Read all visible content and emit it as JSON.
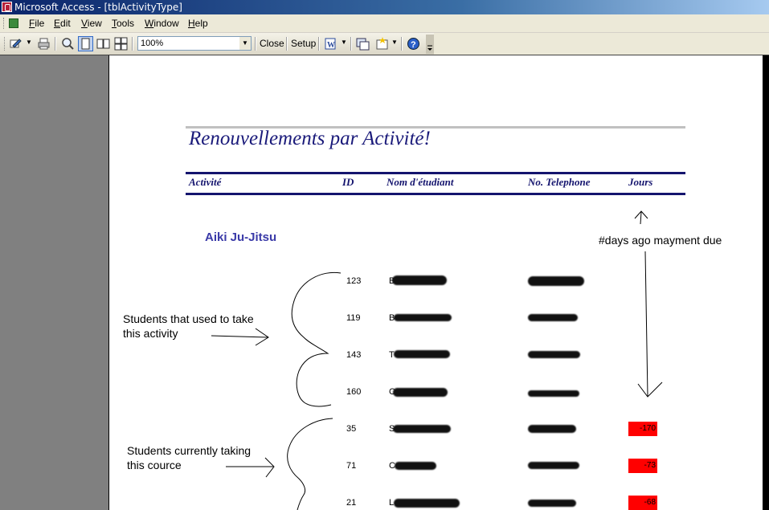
{
  "window": {
    "title": "Microsoft Access - [tblActivityType]"
  },
  "menu": {
    "items": [
      {
        "label": "File",
        "key": "F",
        "rest": "ile"
      },
      {
        "label": "Edit",
        "key": "E",
        "rest": "dit"
      },
      {
        "label": "View",
        "key": "V",
        "rest": "iew"
      },
      {
        "label": "Tools",
        "key": "T",
        "rest": "ools"
      },
      {
        "label": "Window",
        "key": "W",
        "rest": "indow"
      },
      {
        "label": "Help",
        "key": "H",
        "rest": "elp"
      }
    ]
  },
  "toolbar": {
    "zoom_value": "100%",
    "close_label": "Close",
    "setup_label": "Setup"
  },
  "report": {
    "title": "Renouvellements par Activité!",
    "columns": {
      "activite": "Activité",
      "id": "ID",
      "nom": "Nom d'étudiant",
      "telephone": "No. Telephone",
      "jours": "Jours"
    },
    "group_name": "Aiki Ju-Jitsu",
    "rows": [
      {
        "id": "123",
        "name_initial": "B",
        "jours": ""
      },
      {
        "id": "119",
        "name_initial": "B",
        "jours": ""
      },
      {
        "id": "143",
        "name_initial": "T",
        "jours": ""
      },
      {
        "id": "160",
        "name_initial": "C",
        "jours": ""
      },
      {
        "id": "35",
        "name_initial": "S",
        "jours": "-170"
      },
      {
        "id": "71",
        "name_initial": "C",
        "jours": "-73"
      },
      {
        "id": "21",
        "name_initial": "L",
        "jours": "-68"
      }
    ]
  },
  "annotations": {
    "days_label": "#days ago mayment due",
    "past_line1": "Students that used to take",
    "past_line2": "this activity",
    "current_line1": "Students currently taking",
    "current_line2": "this cource"
  },
  "colors": {
    "title_navy": "#1a1a7a",
    "overdue_red": "#ff0000",
    "group_blue": "#3a3aa8"
  }
}
